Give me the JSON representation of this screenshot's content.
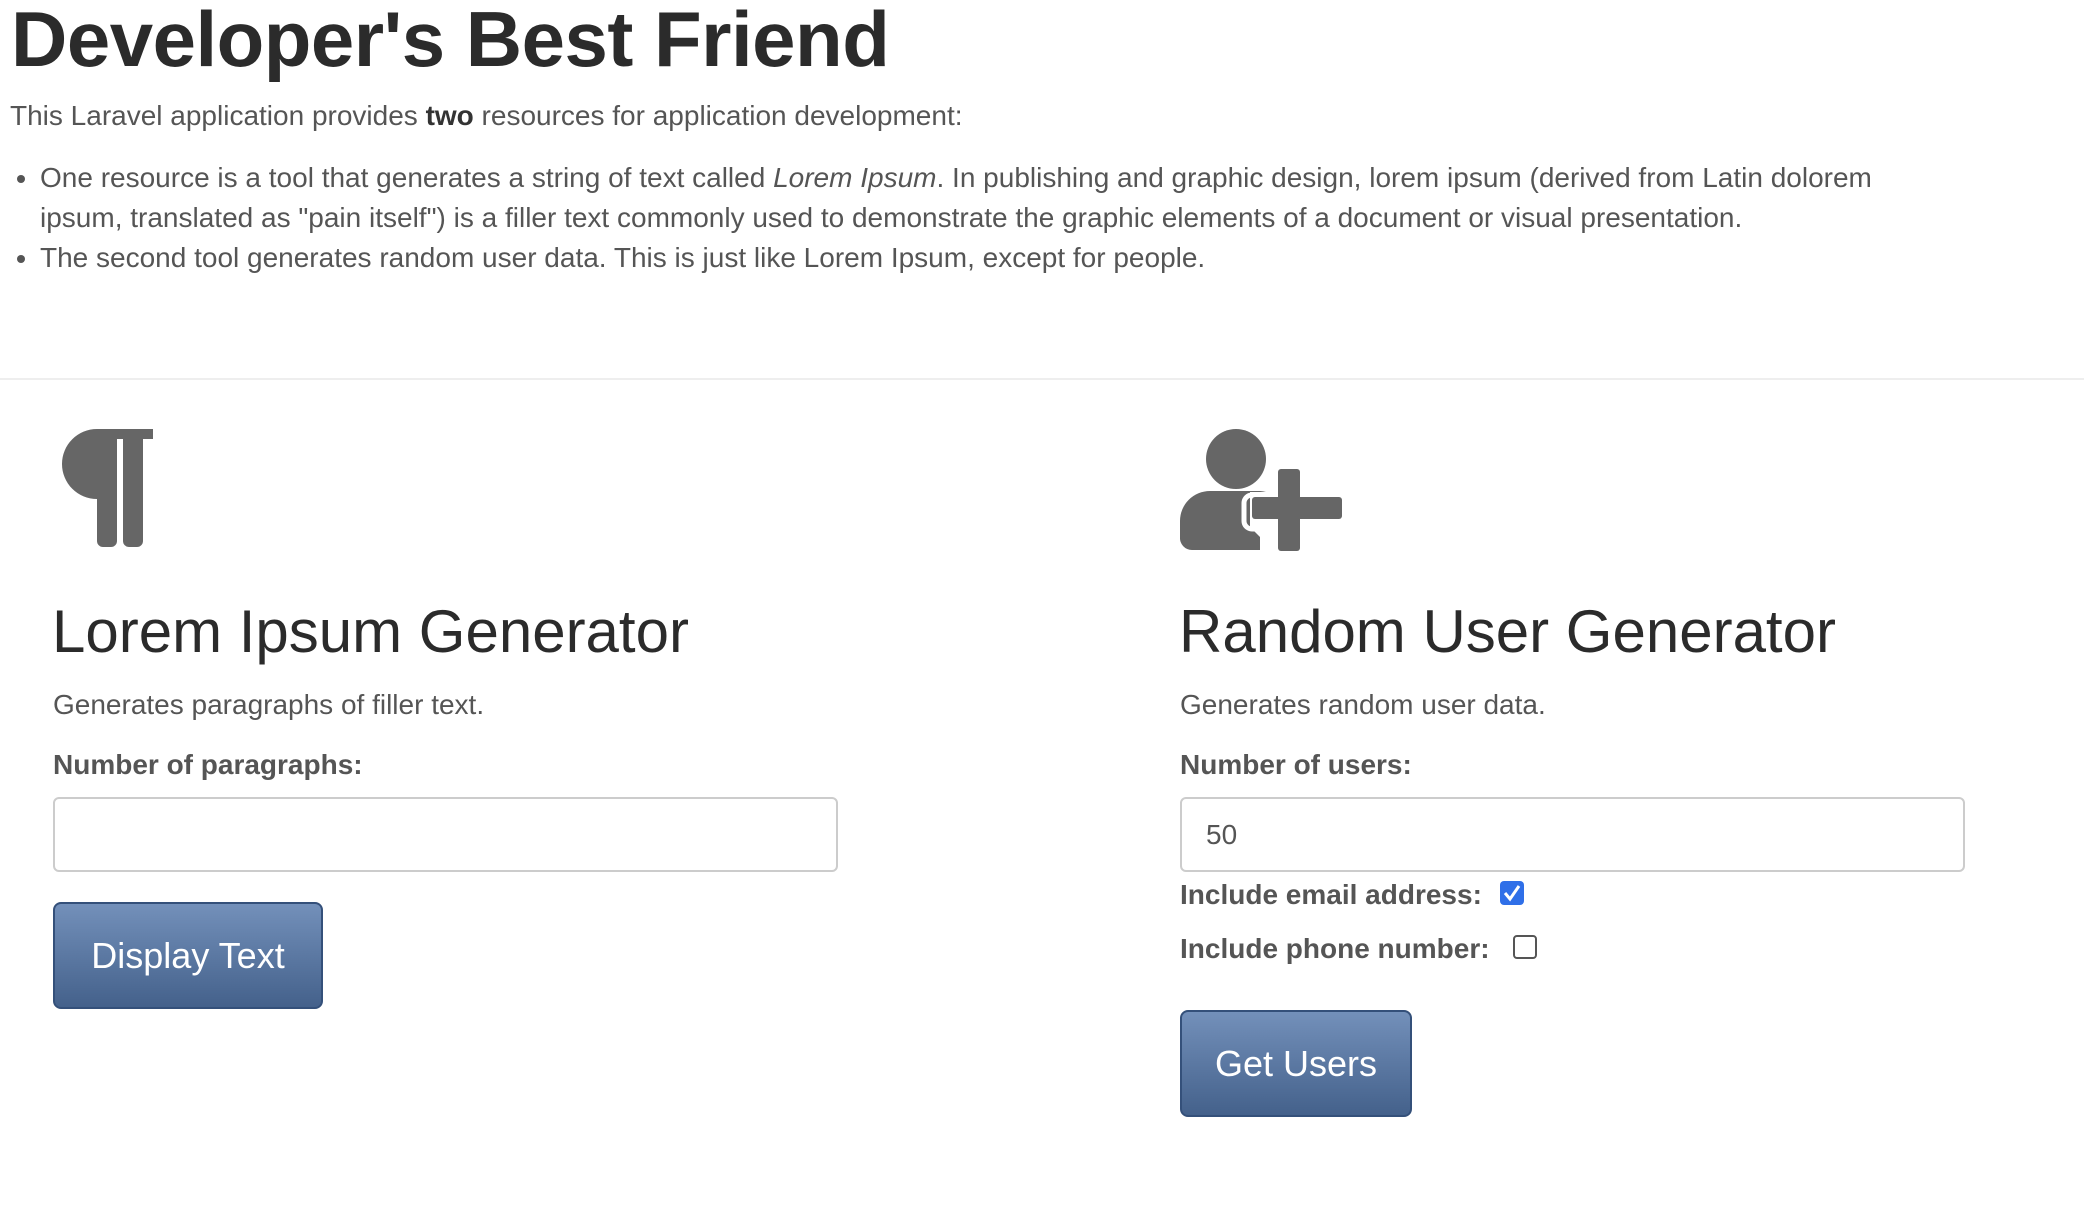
{
  "header": {
    "title": "Developer's Best Friend",
    "intro_pre": "This Laravel application provides ",
    "intro_bold": "two",
    "intro_post": " resources for application development:",
    "bullets": [
      {
        "pre": "One resource is a tool that generates a string of text called ",
        "em": "Lorem Ipsum",
        "post": ". In publishing and graphic design, lorem ipsum (derived from Latin dolorem ipsum, translated as \"pain itself\") is a filler text commonly used to demonstrate the graphic elements of a document or visual presentation."
      },
      {
        "text": "The second tool generates random user data. This is just like Lorem Ipsum, except for people."
      }
    ]
  },
  "lorem": {
    "icon": "paragraph-icon",
    "title": "Lorem Ipsum Generator",
    "description": "Generates paragraphs of filler text.",
    "field_label": "Number of paragraphs:",
    "field_value": "",
    "button_label": "Display Text"
  },
  "users": {
    "icon": "user-plus-icon",
    "title": "Random User Generator",
    "description": "Generates random user data.",
    "field_label": "Number of users:",
    "field_value": "50",
    "email_label": "Include email address:",
    "email_checked": true,
    "phone_label": "Include phone number:",
    "phone_checked": false,
    "button_label": "Get Users"
  },
  "colors": {
    "icon": "#666666",
    "button": "#4a6690",
    "checkbox": "#2f6fe8"
  }
}
